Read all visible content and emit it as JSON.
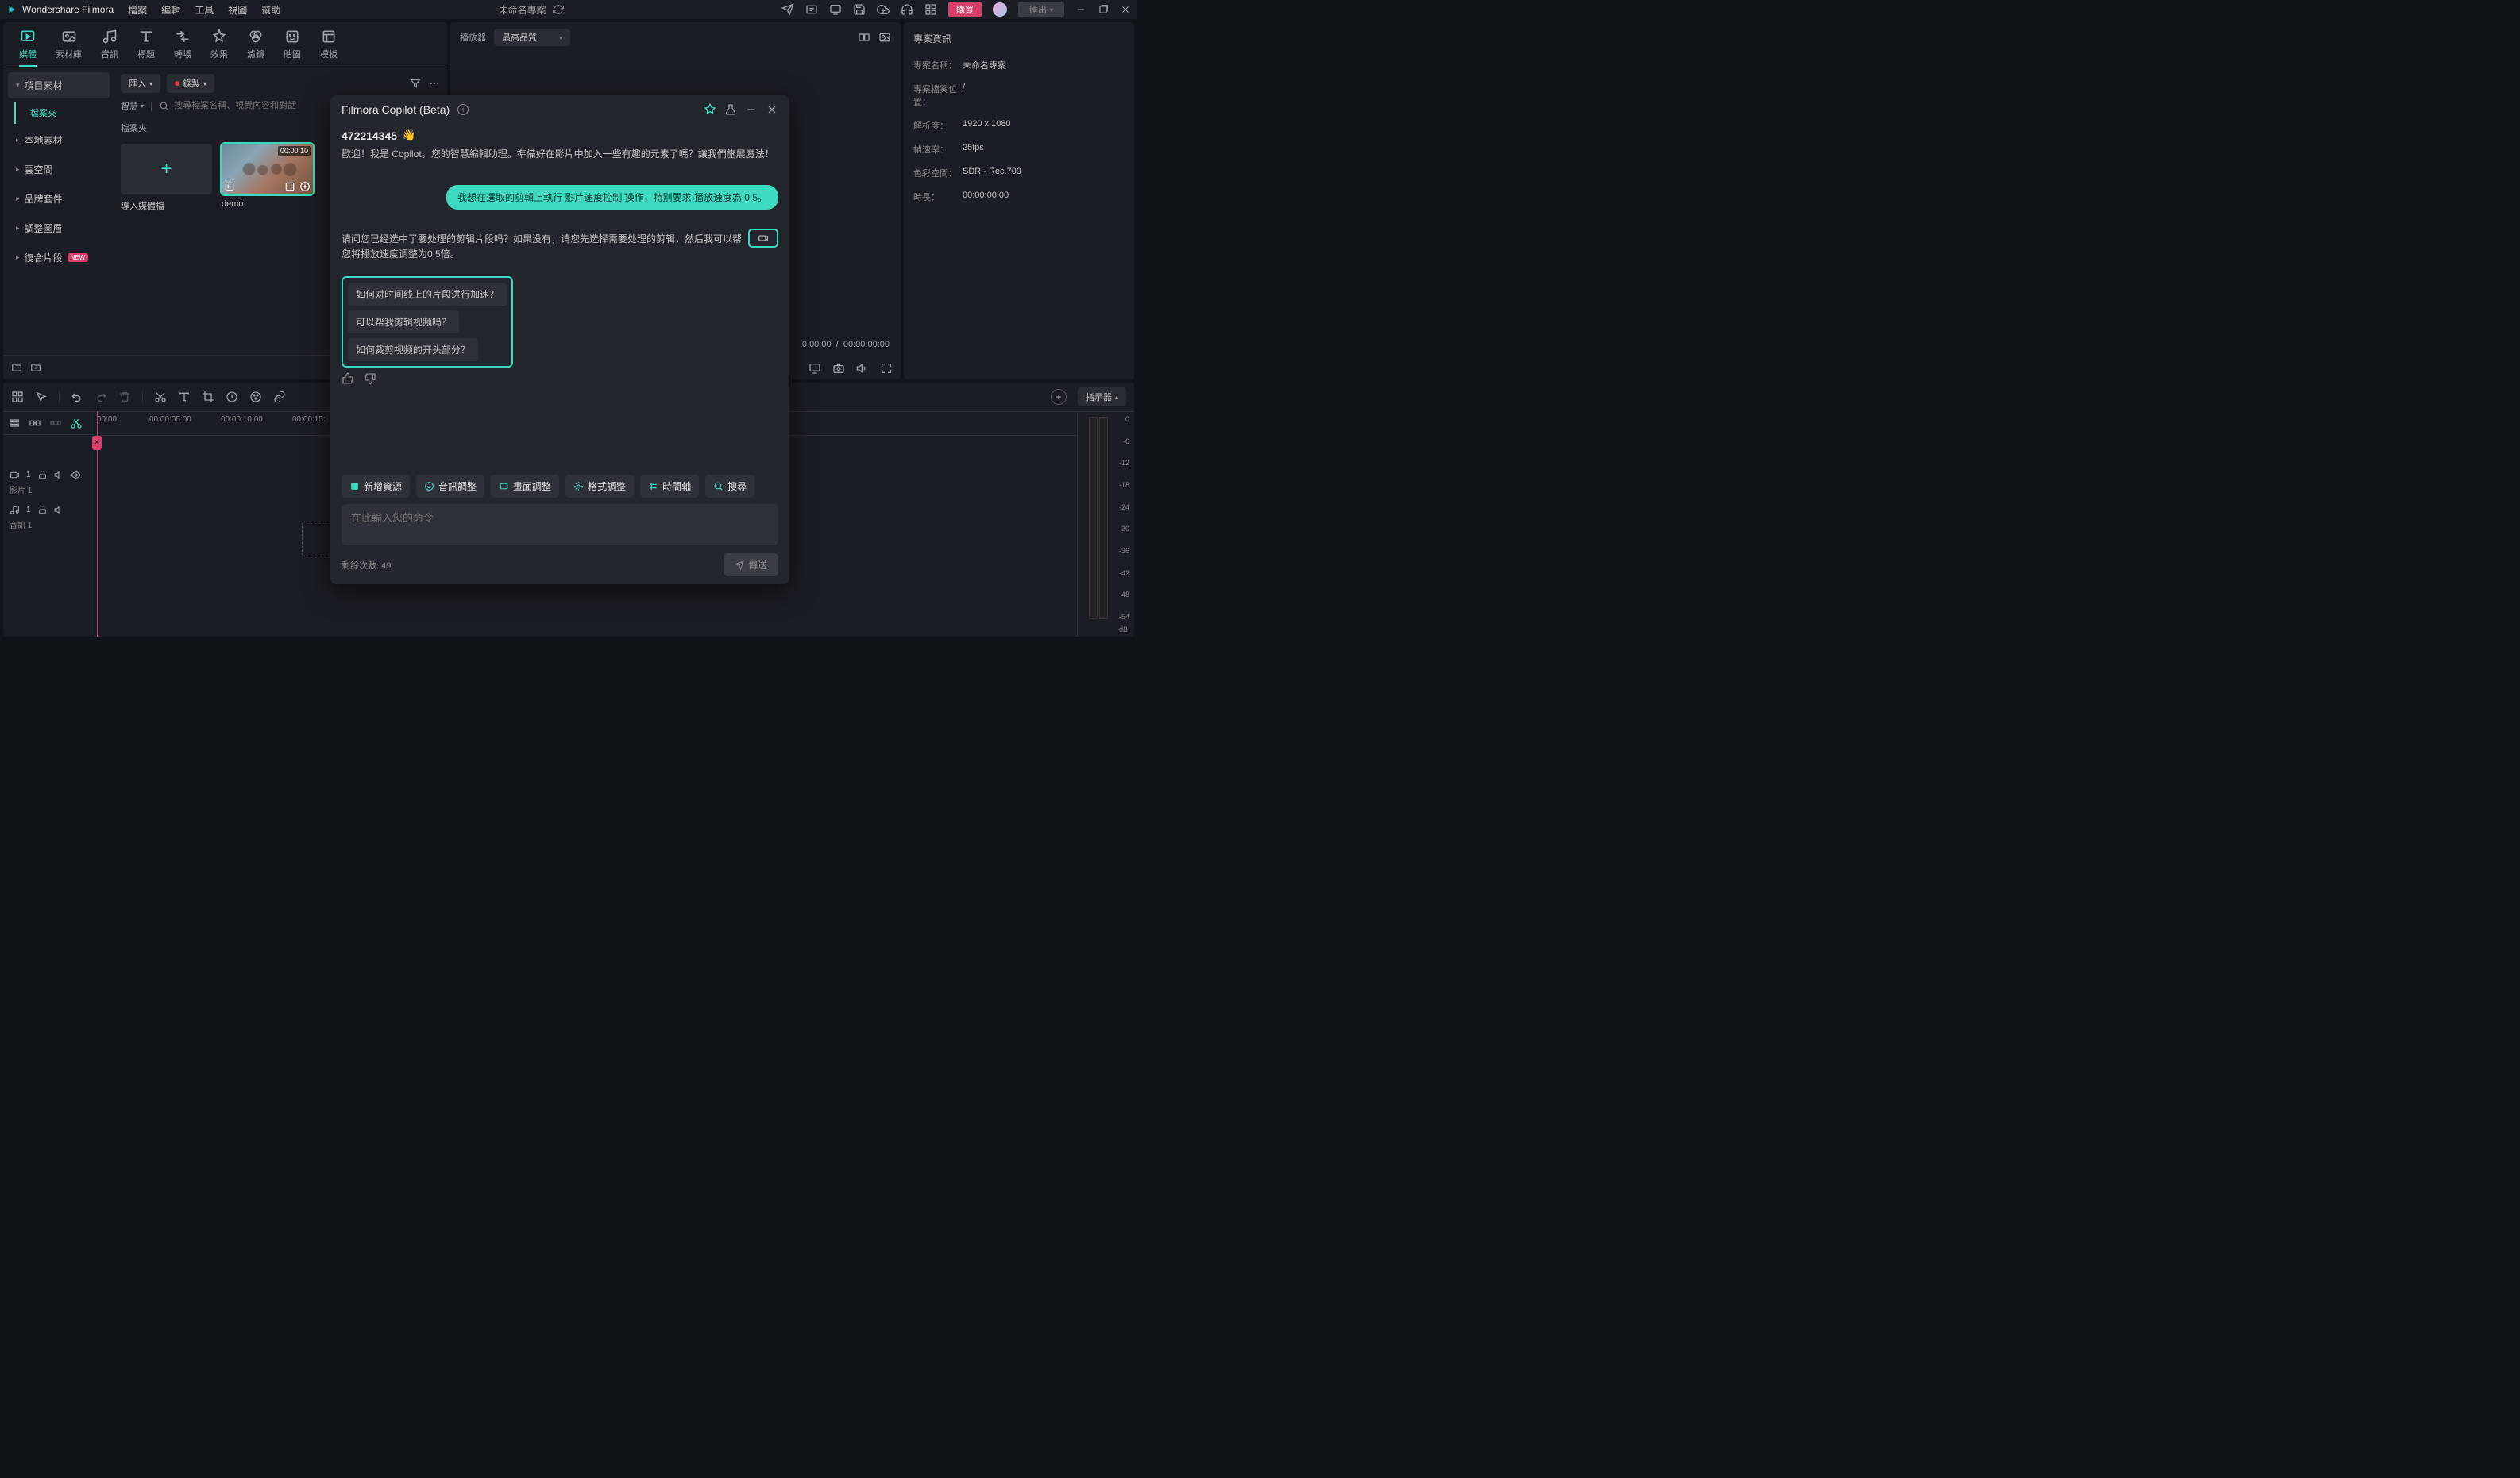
{
  "app": {
    "name": "Wondershare Filmora",
    "project_title": "未命名專案"
  },
  "menu": {
    "file": "檔案",
    "edit": "編輯",
    "tools": "工具",
    "view": "視圖",
    "help": "幫助"
  },
  "menubar_right": {
    "buy": "購買",
    "export": "匯出"
  },
  "top_tabs": {
    "media": "媒體",
    "stock": "素材庫",
    "audio": "音訊",
    "title": "標題",
    "transition": "轉場",
    "effect": "效果",
    "filter": "濾鏡",
    "sticker": "貼圖",
    "template": "模板"
  },
  "sidebar": {
    "project_media": "項目素材",
    "folder": "檔案夾",
    "local": "本地素材",
    "cloud": "雲空間",
    "brand": "品牌套件",
    "adjust_layer": "調整圖層",
    "composite": "復合片段",
    "new_badge": "NEW"
  },
  "media_toolbar": {
    "import": "匯入",
    "record": "錄製"
  },
  "media_search": {
    "smart": "智慧",
    "placeholder": "搜尋檔案名稱、視覺內容和對話"
  },
  "media": {
    "section_label": "檔案夾",
    "import_tile": "導入媒體檔",
    "clip_name": "demo",
    "clip_duration": "00:00:10"
  },
  "player": {
    "label": "播放器",
    "quality": "最高品質",
    "time_current": "0:00:00",
    "time_total": "00:00:00:00"
  },
  "project_info": {
    "heading": "專案資訊",
    "rows": {
      "name_k": "專案名稱：",
      "name_v": "未命名專案",
      "path_k": "專案檔案位置：",
      "path_v": "/",
      "res_k": "解析度：",
      "res_v": "1920 x 1080",
      "fps_k": "幀速率：",
      "fps_v": "25fps",
      "cs_k": "色彩空間：",
      "cs_v": "SDR - Rec.709",
      "dur_k": "時長：",
      "dur_v": "00:00:00:00"
    }
  },
  "timeline": {
    "indicator": "指示器",
    "ruler": [
      "00:00",
      "00:00:05:00",
      "00:00:10:00",
      "00:00:15:"
    ],
    "video_track": "影片 1",
    "audio_track": "音訊 1",
    "meter": [
      "0",
      "-6",
      "-12",
      "-18",
      "-24",
      "-30",
      "-36",
      "-42",
      "-48",
      "-54"
    ],
    "meter_unit": "dB"
  },
  "copilot": {
    "title": "Filmora Copilot (Beta)",
    "user_id": "472214345",
    "wave": "👋",
    "greeting": "歡迎！我是 Copilot，您的智慧編輯助理。準備好在影片中加入一些有趣的元素了嗎？讓我們施展魔法！",
    "user_msg": "我想在選取的剪輯上執行 影片速度控制 操作，特別要求 播放速度為 0.5。",
    "assistant_msg": "请问您已经选中了要处理的剪辑片段吗？如果没有，请您先选择需要处理的剪辑，然后我可以帮您将播放速度调整为0.5倍。",
    "suggestions": [
      "如何对时间线上的片段进行加速？",
      "可以帮我剪辑视频吗？",
      "如何裁剪视频的开头部分？"
    ],
    "chips": {
      "add": "新增資源",
      "audio": "音訊調整",
      "visual": "畫面調整",
      "format": "格式調整",
      "timeline": "時間軸",
      "search": "搜尋"
    },
    "input_placeholder": "在此輸入您的命令",
    "remaining": "剩餘次數: 49",
    "send": "傳送"
  }
}
